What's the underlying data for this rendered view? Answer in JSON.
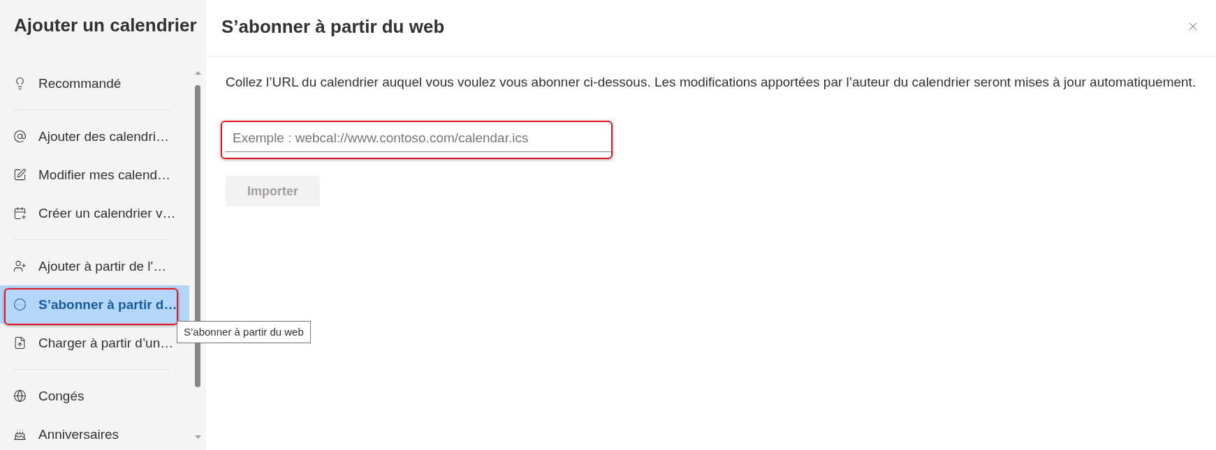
{
  "sidebar": {
    "title": "Ajouter un calendrier",
    "groups": [
      {
        "items": [
          {
            "label": "Recommandé",
            "selected": false,
            "outlined": false
          }
        ]
      },
      {
        "items": [
          {
            "label": "Ajouter des calendri…",
            "selected": false,
            "outlined": false
          },
          {
            "label": "Modifier mes calend…",
            "selected": false,
            "outlined": false
          },
          {
            "label": "Créer un calendrier v…",
            "selected": false,
            "outlined": false
          }
        ]
      },
      {
        "items": [
          {
            "label": "Ajouter à partir de l'…",
            "selected": false,
            "outlined": false
          },
          {
            "label": "S’abonner à partir d…",
            "selected": true,
            "outlined": true
          },
          {
            "label": "Charger à partir d’un…",
            "selected": false,
            "outlined": false
          }
        ]
      },
      {
        "items": [
          {
            "label": "Congés",
            "selected": false,
            "outlined": false
          },
          {
            "label": "Anniversaires",
            "selected": false,
            "outlined": false
          }
        ]
      }
    ]
  },
  "tooltip": {
    "text": "S’abonner à partir du web"
  },
  "panel": {
    "title": "S’abonner à partir du web",
    "description": "Collez l’URL du calendrier auquel vous voulez vous abonner ci-dessous. Les modifications apportées par l’auteur du calendrier seront mises à jour automatiquement.",
    "url_field": {
      "placeholder": "Exemple : webcal://www.contoso.com/calendar.ics",
      "outlined": true
    },
    "import_button": {
      "label": "Importer",
      "disabled": true
    }
  }
}
